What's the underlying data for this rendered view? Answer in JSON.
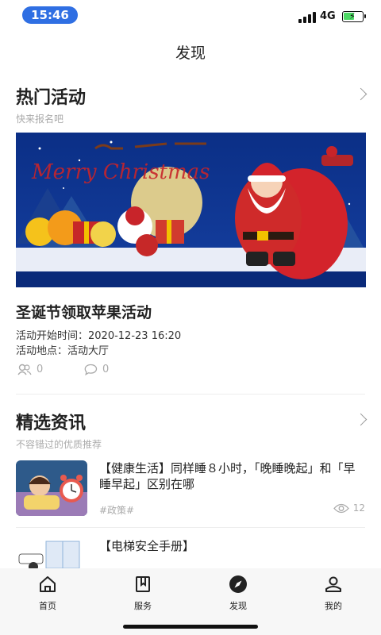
{
  "status_bar": {
    "time": "15:46",
    "network": "4G"
  },
  "nav": {
    "title": "发现"
  },
  "activities": {
    "title": "热门活动",
    "subtitle": "快来报名吧",
    "event": {
      "title": "圣诞节领取苹果活动",
      "start_time_label": "活动开始时间：",
      "start_time": "2020-12-23 16:20",
      "location_label": "活动地点：",
      "location": "活动大厅",
      "participants": "0",
      "comments": "0"
    }
  },
  "news": {
    "title": "精选资讯",
    "subtitle": "不容错过的优质推荐",
    "items": [
      {
        "title": "【健康生活】同样睡８小时，「晚睡晚起」和「早睡早起」区别在哪",
        "tag": "#政策#",
        "views": "12"
      },
      {
        "title": "【电梯安全手册】"
      }
    ]
  },
  "tabbar": {
    "items": [
      {
        "label": "首页",
        "icon": "home-icon"
      },
      {
        "label": "服务",
        "icon": "book-icon"
      },
      {
        "label": "发现",
        "icon": "compass-icon"
      },
      {
        "label": "我的",
        "icon": "user-icon"
      }
    ]
  },
  "colors": {
    "accent": "#2f6fe3",
    "muted_text": "#aaaaaa"
  }
}
